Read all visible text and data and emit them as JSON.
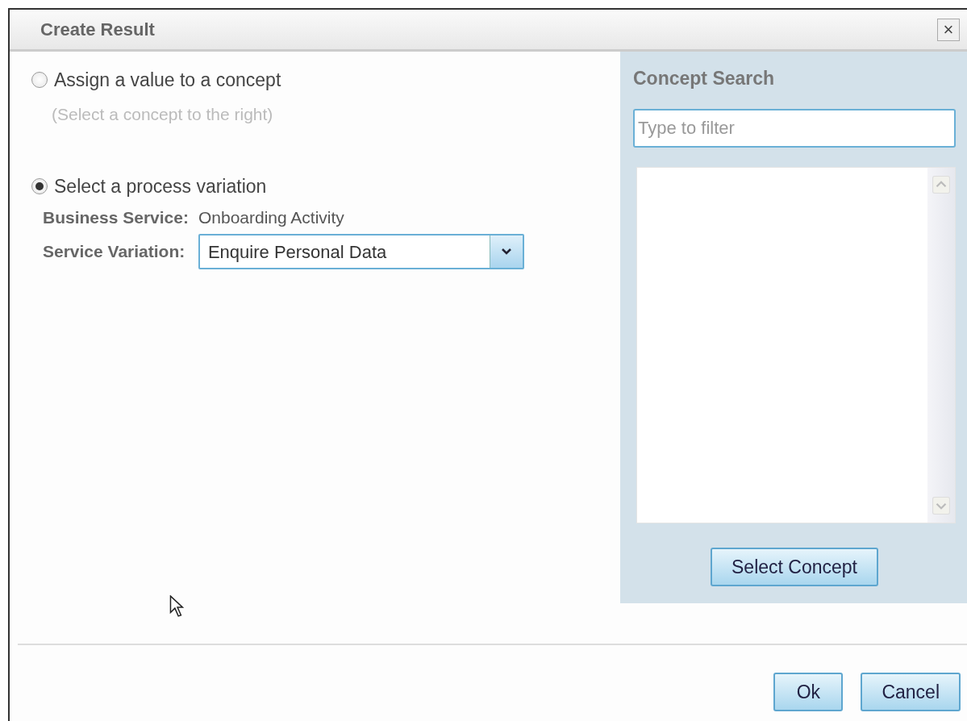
{
  "dialog": {
    "title": "Create Result",
    "close": "×"
  },
  "options": [
    {
      "label": "Assign a value to a concept",
      "selected": false,
      "hint": "(Select a concept to the right)"
    },
    {
      "label": "Select a process variation",
      "selected": true
    }
  ],
  "details": {
    "business_service_label": "Business Service:",
    "business_service_value": "Onboarding Activity",
    "service_variation_label": "Service Variation:",
    "service_variation_value": "Enquire Personal Data"
  },
  "concept_search": {
    "title": "Concept Search",
    "placeholder": "Type to filter",
    "button": "Select Concept"
  },
  "buttons": [
    "Ok",
    "Cancel"
  ]
}
